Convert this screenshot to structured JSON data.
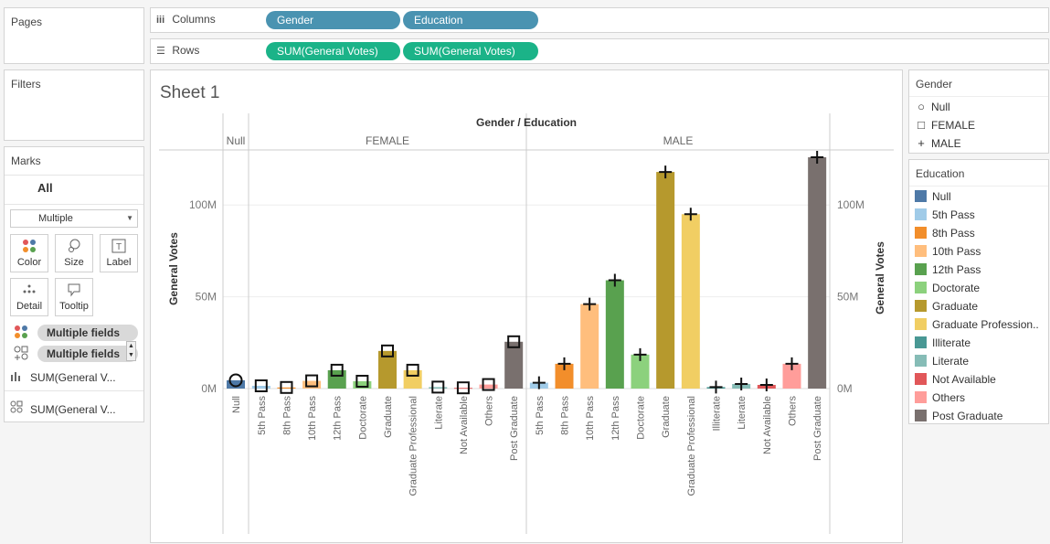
{
  "pages_label": "Pages",
  "filters_label": "Filters",
  "marks": {
    "label": "Marks",
    "all_label": "All",
    "mark_type": "Multiple",
    "buttons": {
      "color": "Color",
      "size": "Size",
      "label": "Label",
      "detail": "Detail",
      "tooltip": "Tooltip"
    },
    "fields": [
      "Multiple fields",
      "Multiple fields"
    ],
    "measures": [
      "SUM(General V...",
      "SUM(General V..."
    ]
  },
  "columns": {
    "label": "Columns",
    "pills": [
      "Gender",
      "Education"
    ]
  },
  "rows": {
    "label": "Rows",
    "pills": [
      "SUM(General Votes)",
      "SUM(General Votes)"
    ]
  },
  "sheet_title": "Sheet 1",
  "gender_legend": {
    "title": "Gender",
    "items": [
      {
        "label": "Null",
        "shape": "○"
      },
      {
        "label": "FEMALE",
        "shape": "□"
      },
      {
        "label": "MALE",
        "shape": "+"
      }
    ]
  },
  "education_legend": {
    "title": "Education",
    "items": [
      {
        "label": "Null",
        "color": "#4e79a7"
      },
      {
        "label": "5th Pass",
        "color": "#a0cbe8"
      },
      {
        "label": "8th Pass",
        "color": "#f28e2b"
      },
      {
        "label": "10th Pass",
        "color": "#ffbe7d"
      },
      {
        "label": "12th Pass",
        "color": "#59a14f"
      },
      {
        "label": "Doctorate",
        "color": "#8cd17d"
      },
      {
        "label": "Graduate",
        "color": "#b6992d"
      },
      {
        "label": "Graduate Profession..",
        "color": "#f1ce63"
      },
      {
        "label": "Illiterate",
        "color": "#499894"
      },
      {
        "label": "Literate",
        "color": "#86bcb6"
      },
      {
        "label": "Not Available",
        "color": "#e15759"
      },
      {
        "label": "Others",
        "color": "#ff9d9a"
      },
      {
        "label": "Post Graduate",
        "color": "#79706e"
      }
    ]
  },
  "chart_data": {
    "type": "bar",
    "title": "Gender / Education",
    "ylabel": "General Votes",
    "ylim": [
      0,
      130000000
    ],
    "y_ticks": [
      "0M",
      "50M",
      "100M"
    ],
    "tick_values": [
      0,
      50000000,
      100000000
    ],
    "panes": [
      {
        "gender": "Null",
        "categories": [
          "Null"
        ],
        "values": [
          4500000
        ]
      },
      {
        "gender": "FEMALE",
        "categories": [
          "5th Pass",
          "8th Pass",
          "10th Pass",
          "12th Pass",
          "Doctorate",
          "Graduate",
          "Graduate Professional",
          "Literate",
          "Not Available",
          "Others",
          "Post Graduate"
        ],
        "values": [
          1500000,
          600000,
          4200000,
          10000000,
          4000000,
          20500000,
          10000000,
          800000,
          400000,
          2200000,
          25500000
        ]
      },
      {
        "gender": "MALE",
        "categories": [
          "5th Pass",
          "8th Pass",
          "10th Pass",
          "12th Pass",
          "Doctorate",
          "Graduate",
          "Graduate Professional",
          "Illiterate",
          "Literate",
          "Not Available",
          "Others",
          "Post Graduate"
        ],
        "values": [
          3200000,
          13500000,
          46000000,
          59000000,
          18500000,
          118000000,
          95000000,
          800000,
          2500000,
          2000000,
          13500000,
          126000000
        ]
      }
    ]
  }
}
